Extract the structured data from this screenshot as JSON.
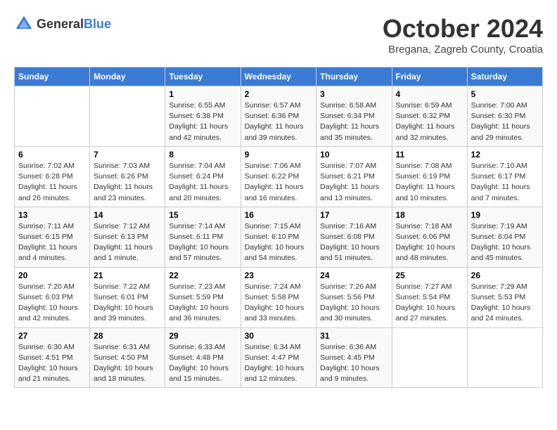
{
  "header": {
    "logo": {
      "text_general": "General",
      "text_blue": "Blue"
    },
    "title": "October 2024",
    "location": "Bregana, Zagreb County, Croatia"
  },
  "days_of_week": [
    "Sunday",
    "Monday",
    "Tuesday",
    "Wednesday",
    "Thursday",
    "Friday",
    "Saturday"
  ],
  "weeks": [
    [
      {
        "num": "",
        "info": ""
      },
      {
        "num": "",
        "info": ""
      },
      {
        "num": "1",
        "info": "Sunrise: 6:55 AM\nSunset: 6:38 PM\nDaylight: 11 hours and 42 minutes."
      },
      {
        "num": "2",
        "info": "Sunrise: 6:57 AM\nSunset: 6:36 PM\nDaylight: 11 hours and 39 minutes."
      },
      {
        "num": "3",
        "info": "Sunrise: 6:58 AM\nSunset: 6:34 PM\nDaylight: 11 hours and 35 minutes."
      },
      {
        "num": "4",
        "info": "Sunrise: 6:59 AM\nSunset: 6:32 PM\nDaylight: 11 hours and 32 minutes."
      },
      {
        "num": "5",
        "info": "Sunrise: 7:00 AM\nSunset: 6:30 PM\nDaylight: 11 hours and 29 minutes."
      }
    ],
    [
      {
        "num": "6",
        "info": "Sunrise: 7:02 AM\nSunset: 6:28 PM\nDaylight: 11 hours and 26 minutes."
      },
      {
        "num": "7",
        "info": "Sunrise: 7:03 AM\nSunset: 6:26 PM\nDaylight: 11 hours and 23 minutes."
      },
      {
        "num": "8",
        "info": "Sunrise: 7:04 AM\nSunset: 6:24 PM\nDaylight: 11 hours and 20 minutes."
      },
      {
        "num": "9",
        "info": "Sunrise: 7:06 AM\nSunset: 6:22 PM\nDaylight: 11 hours and 16 minutes."
      },
      {
        "num": "10",
        "info": "Sunrise: 7:07 AM\nSunset: 6:21 PM\nDaylight: 11 hours and 13 minutes."
      },
      {
        "num": "11",
        "info": "Sunrise: 7:08 AM\nSunset: 6:19 PM\nDaylight: 11 hours and 10 minutes."
      },
      {
        "num": "12",
        "info": "Sunrise: 7:10 AM\nSunset: 6:17 PM\nDaylight: 11 hours and 7 minutes."
      }
    ],
    [
      {
        "num": "13",
        "info": "Sunrise: 7:11 AM\nSunset: 6:15 PM\nDaylight: 11 hours and 4 minutes."
      },
      {
        "num": "14",
        "info": "Sunrise: 7:12 AM\nSunset: 6:13 PM\nDaylight: 11 hours and 1 minute."
      },
      {
        "num": "15",
        "info": "Sunrise: 7:14 AM\nSunset: 6:11 PM\nDaylight: 10 hours and 57 minutes."
      },
      {
        "num": "16",
        "info": "Sunrise: 7:15 AM\nSunset: 6:10 PM\nDaylight: 10 hours and 54 minutes."
      },
      {
        "num": "17",
        "info": "Sunrise: 7:16 AM\nSunset: 6:08 PM\nDaylight: 10 hours and 51 minutes."
      },
      {
        "num": "18",
        "info": "Sunrise: 7:18 AM\nSunset: 6:06 PM\nDaylight: 10 hours and 48 minutes."
      },
      {
        "num": "19",
        "info": "Sunrise: 7:19 AM\nSunset: 6:04 PM\nDaylight: 10 hours and 45 minutes."
      }
    ],
    [
      {
        "num": "20",
        "info": "Sunrise: 7:20 AM\nSunset: 6:03 PM\nDaylight: 10 hours and 42 minutes."
      },
      {
        "num": "21",
        "info": "Sunrise: 7:22 AM\nSunset: 6:01 PM\nDaylight: 10 hours and 39 minutes."
      },
      {
        "num": "22",
        "info": "Sunrise: 7:23 AM\nSunset: 5:59 PM\nDaylight: 10 hours and 36 minutes."
      },
      {
        "num": "23",
        "info": "Sunrise: 7:24 AM\nSunset: 5:58 PM\nDaylight: 10 hours and 33 minutes."
      },
      {
        "num": "24",
        "info": "Sunrise: 7:26 AM\nSunset: 5:56 PM\nDaylight: 10 hours and 30 minutes."
      },
      {
        "num": "25",
        "info": "Sunrise: 7:27 AM\nSunset: 5:54 PM\nDaylight: 10 hours and 27 minutes."
      },
      {
        "num": "26",
        "info": "Sunrise: 7:29 AM\nSunset: 5:53 PM\nDaylight: 10 hours and 24 minutes."
      }
    ],
    [
      {
        "num": "27",
        "info": "Sunrise: 6:30 AM\nSunset: 4:51 PM\nDaylight: 10 hours and 21 minutes."
      },
      {
        "num": "28",
        "info": "Sunrise: 6:31 AM\nSunset: 4:50 PM\nDaylight: 10 hours and 18 minutes."
      },
      {
        "num": "29",
        "info": "Sunrise: 6:33 AM\nSunset: 4:48 PM\nDaylight: 10 hours and 15 minutes."
      },
      {
        "num": "30",
        "info": "Sunrise: 6:34 AM\nSunset: 4:47 PM\nDaylight: 10 hours and 12 minutes."
      },
      {
        "num": "31",
        "info": "Sunrise: 6:36 AM\nSunset: 4:45 PM\nDaylight: 10 hours and 9 minutes."
      },
      {
        "num": "",
        "info": ""
      },
      {
        "num": "",
        "info": ""
      }
    ]
  ]
}
